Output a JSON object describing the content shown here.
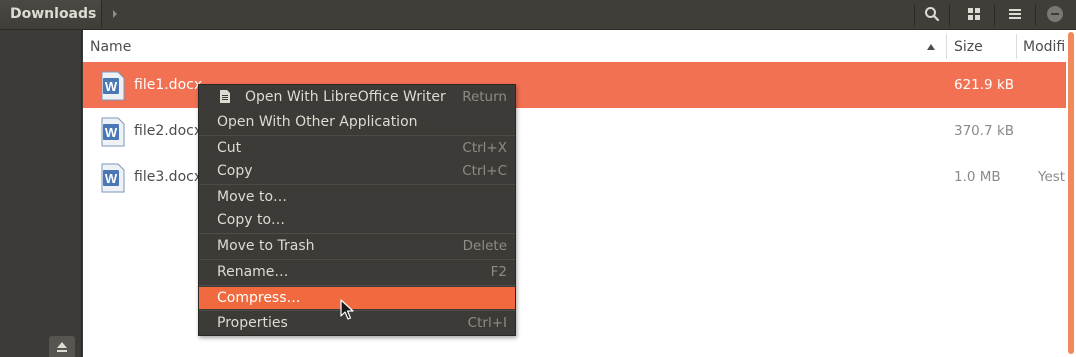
{
  "header": {
    "path_label": "Downloads",
    "icons": {
      "arrow": "chevron-right-icon",
      "search": "search-icon",
      "view": "grid-view-icon",
      "menu": "hamburger-menu-icon",
      "minimize": "minimize-icon"
    }
  },
  "filelist": {
    "columns": {
      "name": "Name",
      "size": "Size",
      "modified": "Modifi"
    },
    "rows": [
      {
        "name": "file1.docx",
        "size": "621.9 kB",
        "modified": "",
        "selected": true
      },
      {
        "name": "file2.docx",
        "size": "370.7 kB",
        "modified": "",
        "selected": false
      },
      {
        "name": "file3.docx",
        "size": "1.0 MB",
        "modified": "Yest",
        "selected": false
      }
    ]
  },
  "context_menu": {
    "items": [
      {
        "label": "Open With LibreOffice Writer",
        "accel": "Return"
      },
      {
        "label": "Open With Other Application",
        "accel": ""
      },
      {
        "label": "Cut",
        "accel": "Ctrl+X"
      },
      {
        "label": "Copy",
        "accel": "Ctrl+C"
      },
      {
        "label": "Move to…",
        "accel": ""
      },
      {
        "label": "Copy to…",
        "accel": ""
      },
      {
        "label": "Move to Trash",
        "accel": "Delete"
      },
      {
        "label": "Rename…",
        "accel": "F2"
      },
      {
        "label": "Compress…",
        "accel": ""
      },
      {
        "label": "Properties",
        "accel": "Ctrl+I"
      }
    ]
  },
  "colors": {
    "selection": "#f37153",
    "menu_highlight": "#f16a3f",
    "menu_bg": "#3c3b37",
    "header_bg": "#3f3e39"
  }
}
